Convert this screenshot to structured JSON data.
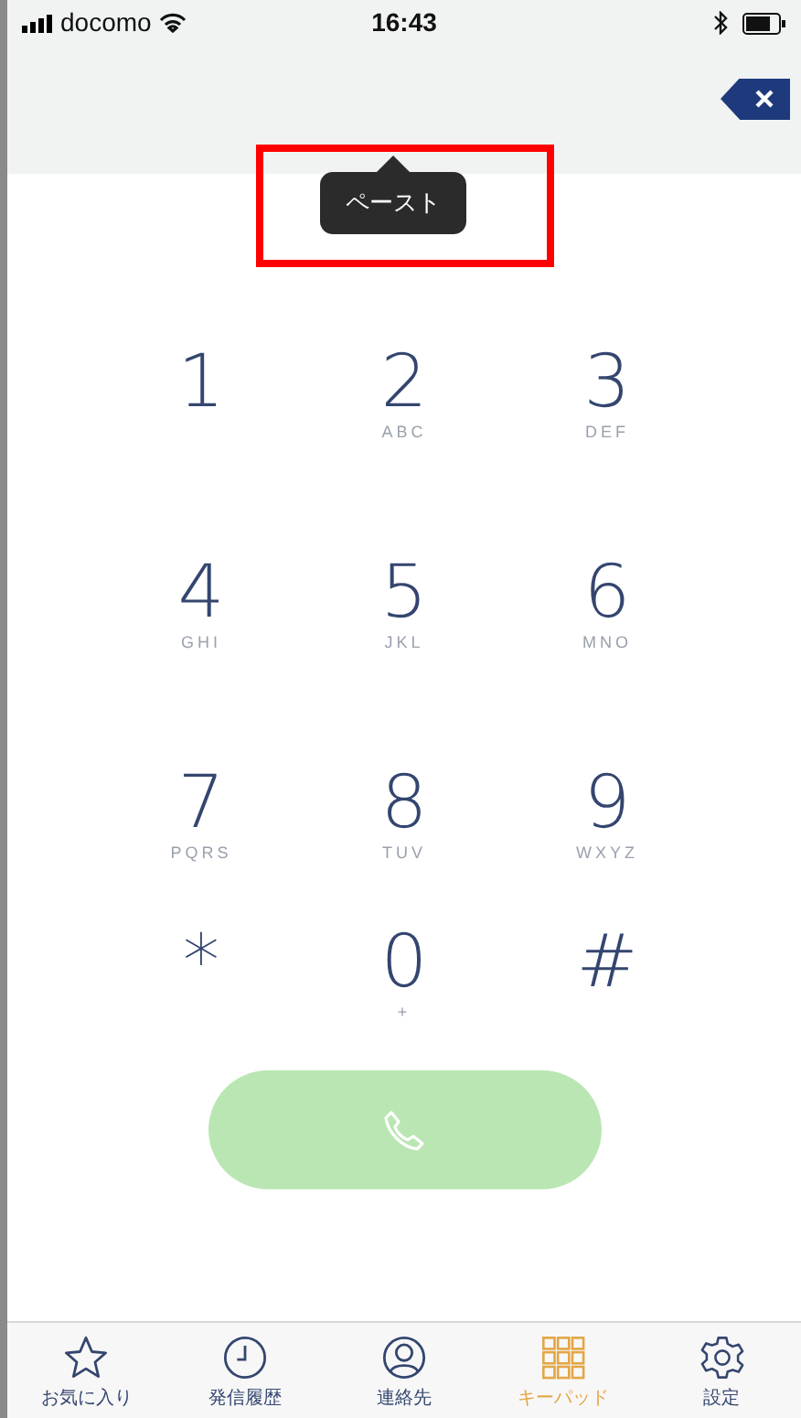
{
  "status_bar": {
    "carrier": "docomo",
    "time": "16:43"
  },
  "tooltip": {
    "text": "ペースト"
  },
  "keys": [
    {
      "digit": "1"
    },
    {
      "digit": "2",
      "letters": "ABC"
    },
    {
      "digit": "3",
      "letters": "DEF"
    },
    {
      "digit": "4",
      "letters": "GHI"
    },
    {
      "digit": "5",
      "letters": "JKL"
    },
    {
      "digit": "6",
      "letters": "MNO"
    },
    {
      "digit": "7",
      "letters": "PQRS"
    },
    {
      "digit": "8",
      "letters": "TUV"
    },
    {
      "digit": "9",
      "letters": "WXYZ"
    },
    {
      "digit": "*"
    },
    {
      "digit": "0",
      "letters": "+"
    },
    {
      "digit": "#"
    }
  ],
  "tabs": [
    {
      "kind": "star",
      "label": "お気に入り",
      "selected": false
    },
    {
      "kind": "clock",
      "label": "発信履歴",
      "selected": false
    },
    {
      "kind": "person",
      "label": "連絡先",
      "selected": false
    },
    {
      "kind": "grid",
      "label": "キーパッド",
      "selected": true
    },
    {
      "kind": "gear",
      "label": "設定",
      "selected": false
    }
  ]
}
